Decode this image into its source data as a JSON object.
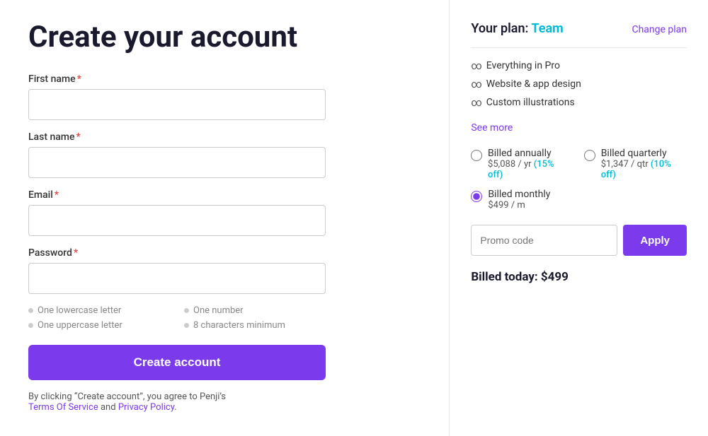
{
  "left": {
    "title": "Create your account",
    "fields": {
      "first_name": {
        "label": "First name",
        "placeholder": ""
      },
      "last_name": {
        "label": "Last name",
        "placeholder": ""
      },
      "email": {
        "label": "Email",
        "placeholder": ""
      },
      "password": {
        "label": "Password",
        "placeholder": ""
      }
    },
    "password_hints": [
      "One lowercase letter",
      "One number",
      "One uppercase letter",
      "8 characters minimum"
    ],
    "create_button": "Create account",
    "terms_text_before": "By clicking “Create account”, you agree to Penji’s",
    "terms_of_service": "Terms Of Service",
    "terms_and": "and",
    "privacy_policy": "Privacy Policy",
    "terms_period": "."
  },
  "right": {
    "plan_label": "Your plan:",
    "plan_name": "Team",
    "change_plan": "Change plan",
    "features": [
      "Everything in Pro",
      "Website & app design",
      "Custom illustrations"
    ],
    "see_more": "See more",
    "billing_options": [
      {
        "id": "annually",
        "label": "Billed annually",
        "price": "$5,088 / yr",
        "discount": "15% off",
        "checked": false
      },
      {
        "id": "quarterly",
        "label": "Billed quarterly",
        "price": "$1,347 / qtr",
        "discount": "10% off",
        "checked": false
      },
      {
        "id": "monthly",
        "label": "Billed monthly",
        "price": "$499 / m",
        "discount": "",
        "checked": true
      }
    ],
    "promo_placeholder": "Promo code",
    "apply_button": "Apply",
    "billed_today": "Billed today: $499"
  }
}
